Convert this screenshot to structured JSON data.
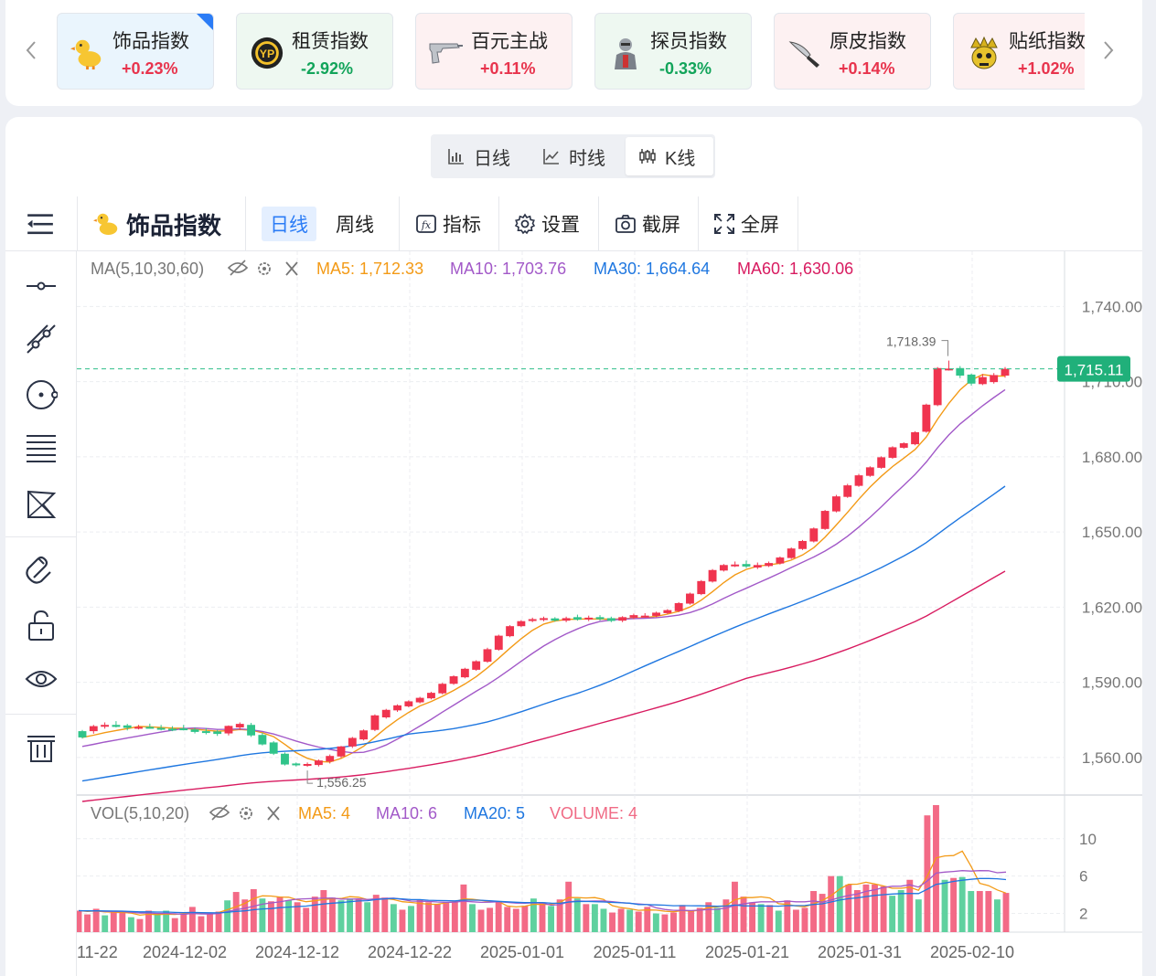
{
  "index_strip": {
    "cards": [
      {
        "name": "饰品指数",
        "change": "+0.23%",
        "direction": "up",
        "selected": true,
        "icon": "duck-icon"
      },
      {
        "name": "租赁指数",
        "change": "-2.92%",
        "direction": "down",
        "selected": false,
        "icon": "yp-coin-icon"
      },
      {
        "name": "百元主战",
        "change": "+0.11%",
        "direction": "up",
        "selected": false,
        "icon": "pistol-icon"
      },
      {
        "name": "探员指数",
        "change": "-0.33%",
        "direction": "down",
        "selected": false,
        "icon": "agent-icon"
      },
      {
        "name": "原皮指数",
        "change": "+0.14%",
        "direction": "up",
        "selected": false,
        "icon": "knife-icon"
      },
      {
        "name": "贴纸指数",
        "change": "+1.02%",
        "direction": "up",
        "selected": false,
        "icon": "crown-skull-icon"
      }
    ],
    "colors": {
      "up": "#e8344d",
      "down": "#12a45a",
      "up_bg": "#fdf1f2",
      "down_bg": "#eef8f1",
      "selected_bg": "#eaf5fd",
      "accent": "#2b7cf6"
    }
  },
  "period_switch": {
    "tabs": [
      {
        "label": "日线",
        "icon": "bar-chart-icon",
        "active": false
      },
      {
        "label": "时线",
        "icon": "line-chart-icon",
        "active": false
      },
      {
        "label": "K线",
        "icon": "candlestick-icon",
        "active": true
      }
    ]
  },
  "toolbar": {
    "menu_icon": "menu-collapse-icon",
    "symbol_icon": "duck-icon",
    "symbol": "饰品指数",
    "periods": [
      {
        "label": "日线",
        "active": true
      },
      {
        "label": "周线",
        "active": false
      }
    ],
    "indicator_label": "指标",
    "settings_label": "设置",
    "screenshot_label": "截屏",
    "fullscreen_label": "全屏"
  },
  "left_tools": [
    "horizontal-line-icon",
    "trend-line-icon",
    "circle-icon",
    "fibonacci-icon",
    "xabcd-pattern-icon",
    "magnet-icon",
    "unlock-icon",
    "eye-icon",
    "trash-icon"
  ],
  "chart_data": {
    "type": "candlestick",
    "x_tick_labels": [
      "11-22",
      "2024-12-02",
      "2024-12-12",
      "2024-12-22",
      "2025-01-01",
      "2025-01-11",
      "2025-01-21",
      "2025-01-31",
      "2025-02-10"
    ],
    "price_axis": {
      "ticks": [
        "1,560.00",
        "1,590.00",
        "1,620.00",
        "1,650.00",
        "1,680.00",
        "1,710.00",
        "1,740.00"
      ],
      "range": [
        1545,
        1762
      ]
    },
    "last_price": "1,715.11",
    "last_price_value": 1715.11,
    "high_marker": {
      "label": "1,718.39",
      "value": 1718.39
    },
    "low_marker": {
      "label": "1,556.25",
      "value": 1556.25
    },
    "ma_legend": {
      "title": "MA(5,10,30,60)",
      "items": [
        {
          "label": "MA5: 1,712.33",
          "color": "#f39a16"
        },
        {
          "label": "MA10: 1,703.76",
          "color": "#a259c8"
        },
        {
          "label": "MA30: 1,664.64",
          "color": "#1f77e0"
        },
        {
          "label": "MA60: 1,630.06",
          "color": "#d81b60"
        }
      ]
    },
    "vol_legend": {
      "title": "VOL(5,10,20)",
      "items": [
        {
          "label": "MA5: 4",
          "color": "#f39a16"
        },
        {
          "label": "MA10: 6",
          "color": "#a259c8"
        },
        {
          "label": "MA20: 5",
          "color": "#1f77e0"
        },
        {
          "label": "VOLUME: 4",
          "color": "#f06b85"
        }
      ]
    },
    "volume_axis": {
      "ticks": [
        "2",
        "6",
        "10"
      ],
      "range": [
        0,
        13.5
      ]
    },
    "up_color": "#f0344f",
    "down_color": "#30c48a",
    "candles": [
      {
        "o": 1570.5,
        "h": 1571.0,
        "l": 1567.5,
        "c": 1568.0
      },
      {
        "o": 1570.5,
        "h": 1573.0,
        "l": 1569.5,
        "c": 1572.5
      },
      {
        "o": 1572.8,
        "h": 1574.0,
        "l": 1571.5,
        "c": 1573.0
      },
      {
        "o": 1573.0,
        "h": 1574.5,
        "l": 1572.0,
        "c": 1572.2
      },
      {
        "o": 1572.8,
        "h": 1573.4,
        "l": 1570.8,
        "c": 1571.8
      },
      {
        "o": 1572.0,
        "h": 1573.0,
        "l": 1571.2,
        "c": 1572.2
      },
      {
        "o": 1572.2,
        "h": 1573.5,
        "l": 1571.5,
        "c": 1572.0
      },
      {
        "o": 1571.8,
        "h": 1573.0,
        "l": 1570.8,
        "c": 1571.5
      },
      {
        "o": 1571.5,
        "h": 1572.5,
        "l": 1570.5,
        "c": 1571.2
      },
      {
        "o": 1571.6,
        "h": 1573.0,
        "l": 1570.8,
        "c": 1571.2
      },
      {
        "o": 1571.2,
        "h": 1572.0,
        "l": 1569.6,
        "c": 1570.2
      },
      {
        "o": 1570.5,
        "h": 1571.8,
        "l": 1569.2,
        "c": 1570.2
      },
      {
        "o": 1570.4,
        "h": 1571.0,
        "l": 1568.6,
        "c": 1569.4
      },
      {
        "o": 1569.6,
        "h": 1572.8,
        "l": 1568.8,
        "c": 1572.6
      },
      {
        "o": 1572.0,
        "h": 1574.0,
        "l": 1571.0,
        "c": 1573.4
      },
      {
        "o": 1573.0,
        "h": 1573.8,
        "l": 1568.2,
        "c": 1568.8
      },
      {
        "o": 1569.0,
        "h": 1569.8,
        "l": 1564.8,
        "c": 1565.2
      },
      {
        "o": 1566.0,
        "h": 1566.5,
        "l": 1561.0,
        "c": 1561.5
      },
      {
        "o": 1561.5,
        "h": 1562.0,
        "l": 1556.8,
        "c": 1557.2
      },
      {
        "o": 1557.6,
        "h": 1558.0,
        "l": 1556.4,
        "c": 1557.0
      },
      {
        "o": 1557.2,
        "h": 1558.0,
        "l": 1556.25,
        "c": 1557.4
      },
      {
        "o": 1557.0,
        "h": 1559.2,
        "l": 1556.4,
        "c": 1558.8
      },
      {
        "o": 1558.4,
        "h": 1561.2,
        "l": 1557.6,
        "c": 1560.6
      },
      {
        "o": 1560.4,
        "h": 1564.6,
        "l": 1559.8,
        "c": 1564.4
      },
      {
        "o": 1564.4,
        "h": 1568.2,
        "l": 1563.8,
        "c": 1567.8
      },
      {
        "o": 1567.2,
        "h": 1571.2,
        "l": 1566.8,
        "c": 1570.8
      },
      {
        "o": 1571.0,
        "h": 1577.2,
        "l": 1570.5,
        "c": 1576.8
      },
      {
        "o": 1576.0,
        "h": 1579.4,
        "l": 1575.5,
        "c": 1579.0
      },
      {
        "o": 1578.8,
        "h": 1581.2,
        "l": 1578.2,
        "c": 1580.8
      },
      {
        "o": 1580.4,
        "h": 1582.8,
        "l": 1580.0,
        "c": 1582.4
      },
      {
        "o": 1582.0,
        "h": 1584.2,
        "l": 1581.6,
        "c": 1583.8
      },
      {
        "o": 1583.6,
        "h": 1586.2,
        "l": 1583.2,
        "c": 1585.8
      },
      {
        "o": 1585.6,
        "h": 1589.8,
        "l": 1585.2,
        "c": 1589.4
      },
      {
        "o": 1589.4,
        "h": 1592.8,
        "l": 1589.0,
        "c": 1592.4
      },
      {
        "o": 1592.0,
        "h": 1595.8,
        "l": 1591.6,
        "c": 1595.4
      },
      {
        "o": 1595.0,
        "h": 1598.8,
        "l": 1594.6,
        "c": 1598.4
      },
      {
        "o": 1598.2,
        "h": 1603.8,
        "l": 1597.8,
        "c": 1603.2
      },
      {
        "o": 1603.0,
        "h": 1609.0,
        "l": 1602.6,
        "c": 1608.6
      },
      {
        "o": 1608.4,
        "h": 1612.8,
        "l": 1608.0,
        "c": 1612.4
      },
      {
        "o": 1612.4,
        "h": 1614.8,
        "l": 1612.0,
        "c": 1614.4
      },
      {
        "o": 1614.6,
        "h": 1615.8,
        "l": 1614.0,
        "c": 1615.2
      },
      {
        "o": 1615.0,
        "h": 1616.2,
        "l": 1614.4,
        "c": 1615.6
      },
      {
        "o": 1615.5,
        "h": 1616.0,
        "l": 1614.2,
        "c": 1614.6
      },
      {
        "o": 1614.6,
        "h": 1616.2,
        "l": 1614.0,
        "c": 1615.6
      },
      {
        "o": 1616.0,
        "h": 1617.0,
        "l": 1614.6,
        "c": 1615.0
      },
      {
        "o": 1615.2,
        "h": 1616.6,
        "l": 1614.4,
        "c": 1615.8
      },
      {
        "o": 1616.0,
        "h": 1616.8,
        "l": 1614.6,
        "c": 1615.2
      },
      {
        "o": 1615.6,
        "h": 1616.2,
        "l": 1614.0,
        "c": 1614.5
      },
      {
        "o": 1614.6,
        "h": 1616.4,
        "l": 1614.0,
        "c": 1616.0
      },
      {
        "o": 1615.8,
        "h": 1617.4,
        "l": 1615.2,
        "c": 1616.8
      },
      {
        "o": 1616.6,
        "h": 1617.6,
        "l": 1615.8,
        "c": 1616.6
      },
      {
        "o": 1616.5,
        "h": 1618.2,
        "l": 1616.0,
        "c": 1617.8
      },
      {
        "o": 1617.6,
        "h": 1619.2,
        "l": 1617.2,
        "c": 1618.8
      },
      {
        "o": 1618.4,
        "h": 1622.0,
        "l": 1618.0,
        "c": 1621.6
      },
      {
        "o": 1621.4,
        "h": 1625.8,
        "l": 1621.0,
        "c": 1625.4
      },
      {
        "o": 1625.2,
        "h": 1630.8,
        "l": 1624.8,
        "c": 1630.4
      },
      {
        "o": 1630.2,
        "h": 1635.2,
        "l": 1629.8,
        "c": 1634.8
      },
      {
        "o": 1634.6,
        "h": 1637.2,
        "l": 1634.2,
        "c": 1636.8
      },
      {
        "o": 1636.6,
        "h": 1638.2,
        "l": 1636.0,
        "c": 1637.0
      },
      {
        "o": 1637.2,
        "h": 1638.6,
        "l": 1635.6,
        "c": 1636.2
      },
      {
        "o": 1635.8,
        "h": 1637.8,
        "l": 1635.2,
        "c": 1636.8
      },
      {
        "o": 1636.4,
        "h": 1638.2,
        "l": 1636.0,
        "c": 1637.6
      },
      {
        "o": 1637.4,
        "h": 1640.2,
        "l": 1637.0,
        "c": 1639.8
      },
      {
        "o": 1639.6,
        "h": 1643.8,
        "l": 1639.2,
        "c": 1643.4
      },
      {
        "o": 1643.2,
        "h": 1646.8,
        "l": 1642.8,
        "c": 1646.4
      },
      {
        "o": 1646.2,
        "h": 1651.8,
        "l": 1645.8,
        "c": 1651.4
      },
      {
        "o": 1651.2,
        "h": 1658.8,
        "l": 1650.8,
        "c": 1658.4
      },
      {
        "o": 1658.2,
        "h": 1664.8,
        "l": 1657.8,
        "c": 1664.2
      },
      {
        "o": 1664.0,
        "h": 1669.2,
        "l": 1663.6,
        "c": 1668.6
      },
      {
        "o": 1668.4,
        "h": 1673.2,
        "l": 1668.0,
        "c": 1672.6
      },
      {
        "o": 1672.4,
        "h": 1676.2,
        "l": 1672.0,
        "c": 1675.8
      },
      {
        "o": 1675.6,
        "h": 1680.2,
        "l": 1675.2,
        "c": 1679.8
      },
      {
        "o": 1679.6,
        "h": 1684.2,
        "l": 1679.2,
        "c": 1683.8
      },
      {
        "o": 1683.6,
        "h": 1685.8,
        "l": 1683.2,
        "c": 1685.4
      },
      {
        "o": 1685.0,
        "h": 1690.2,
        "l": 1684.6,
        "c": 1689.8
      },
      {
        "o": 1690.0,
        "h": 1701.2,
        "l": 1689.6,
        "c": 1700.8
      },
      {
        "o": 1700.6,
        "h": 1715.8,
        "l": 1700.2,
        "c": 1715.4
      },
      {
        "o": 1715.0,
        "h": 1718.39,
        "l": 1714.4,
        "c": 1715.2
      },
      {
        "o": 1715.4,
        "h": 1716.2,
        "l": 1711.4,
        "c": 1712.4
      },
      {
        "o": 1712.8,
        "h": 1713.2,
        "l": 1708.4,
        "c": 1709.2
      },
      {
        "o": 1709.0,
        "h": 1713.0,
        "l": 1708.6,
        "c": 1711.8
      },
      {
        "o": 1709.8,
        "h": 1713.4,
        "l": 1709.2,
        "c": 1712.6
      },
      {
        "o": 1712.4,
        "h": 1715.8,
        "l": 1711.6,
        "c": 1715.11
      }
    ],
    "volumes": [
      2.3,
      1.9,
      2.5,
      1.8,
      2.2,
      2.1,
      1.6,
      1.4,
      2.3,
      2.0,
      2.3,
      1.5,
      1.9,
      2.7,
      1.7,
      2.0,
      2.2,
      3.4,
      4.3,
      3.5,
      4.6,
      3.6,
      3.3,
      3.8,
      3.4,
      3.2,
      2.6,
      3.8,
      4.5,
      3.7,
      3.4,
      3.6,
      3.5,
      3.2,
      4.0,
      3.7,
      3.0,
      2.4,
      2.8,
      3.5,
      3.2,
      3.0,
      3.2,
      3.3,
      5.1,
      3.0,
      2.4,
      2.6,
      3.3,
      2.7,
      2.5,
      2.8,
      3.6,
      3.2,
      2.8,
      3.5,
      5.4,
      3.6,
      3.0,
      3.0,
      2.5,
      2.1,
      2.5,
      2.4,
      2.2,
      2.7,
      2.0,
      1.9,
      2.1,
      2.9,
      2.3,
      2.6,
      3.2,
      2.6,
      3.5,
      5.4,
      3.8,
      3.2,
      3.0,
      2.9,
      2.3,
      3.4,
      2.4,
      2.6,
      4.4,
      4.1,
      6.0,
      6.0,
      5.1,
      4.5,
      5.1,
      5.1,
      4.9,
      3.9,
      4.5,
      5.6,
      3.5,
      12.5,
      13.6,
      5.6,
      5.8,
      5.9,
      4.4,
      4.4,
      4.4,
      3.5,
      4.2
    ]
  }
}
